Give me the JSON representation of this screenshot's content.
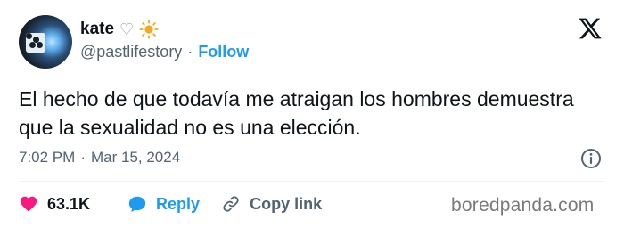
{
  "author": {
    "display_name": "kate",
    "heart": "♡",
    "handle": "@pastlifestory",
    "separator": "·",
    "follow_label": "Follow"
  },
  "tweet": {
    "text": "El hecho de que todavía me atraigan los hombres demuestra que la sexualidad no es una elección."
  },
  "meta": {
    "time": "7:02 PM",
    "separator": "·",
    "date": "Mar 15, 2024"
  },
  "actions": {
    "likes": "63.1K",
    "reply_label": "Reply",
    "copy_label": "Copy link"
  },
  "watermark": "boredpanda.com",
  "colors": {
    "like": "#f91880",
    "link_blue": "#1d9bf0",
    "muted": "#536471",
    "sun": "#f5a623"
  },
  "icons": [
    "avatar",
    "heart-outline-icon",
    "sun-icon",
    "x-logo-icon",
    "info-icon",
    "heart-icon",
    "reply-bubble-icon",
    "link-icon"
  ]
}
